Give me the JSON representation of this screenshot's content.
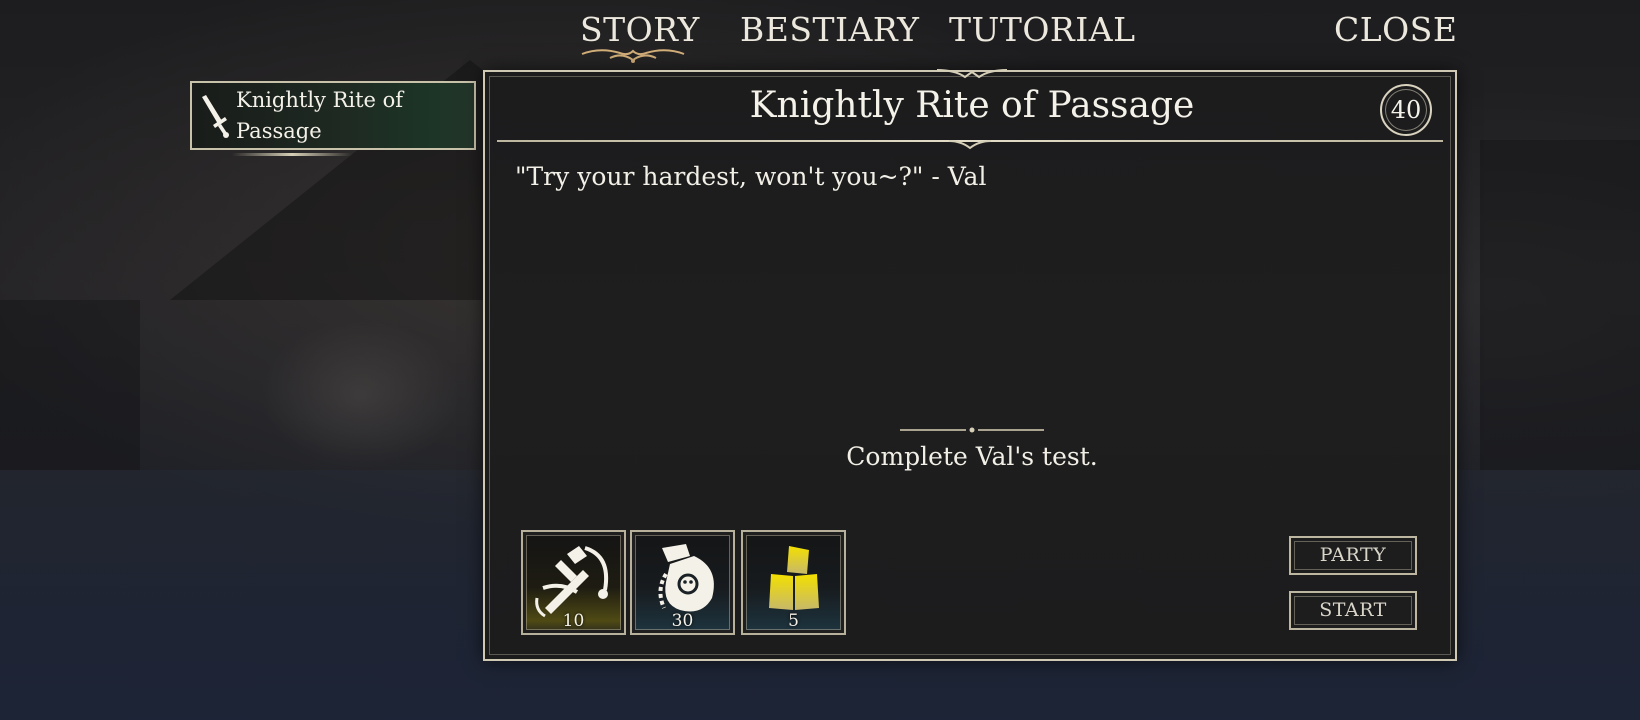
{
  "nav": {
    "tabs": [
      {
        "label": "STORY",
        "active": true
      },
      {
        "label": "BESTIARY",
        "active": false
      },
      {
        "label": "TUTORIAL",
        "active": false
      }
    ],
    "close_label": "CLOSE"
  },
  "quest_list": {
    "items": [
      {
        "label": "Knightly Rite of Passage",
        "icon": "sword-icon",
        "selected": true
      }
    ]
  },
  "quest": {
    "title": "Knightly Rite of Passage",
    "level": "40",
    "quote": "\"Try your hardest, won't you~?\" - Val",
    "objective": "Complete Val's test."
  },
  "rewards": [
    {
      "icon": "crossbow-hammer-icon",
      "count": "10"
    },
    {
      "icon": "potion-pouch-icon",
      "count": "30"
    },
    {
      "icon": "gold-blocks-icon",
      "count": "5"
    }
  ],
  "actions": {
    "party_label": "PARTY",
    "start_label": "START"
  },
  "colors": {
    "frame": "#cfc8b2",
    "panel_bg": "#1c1c1d",
    "selected_item": "#1c3526",
    "gold": "#e8d400"
  }
}
